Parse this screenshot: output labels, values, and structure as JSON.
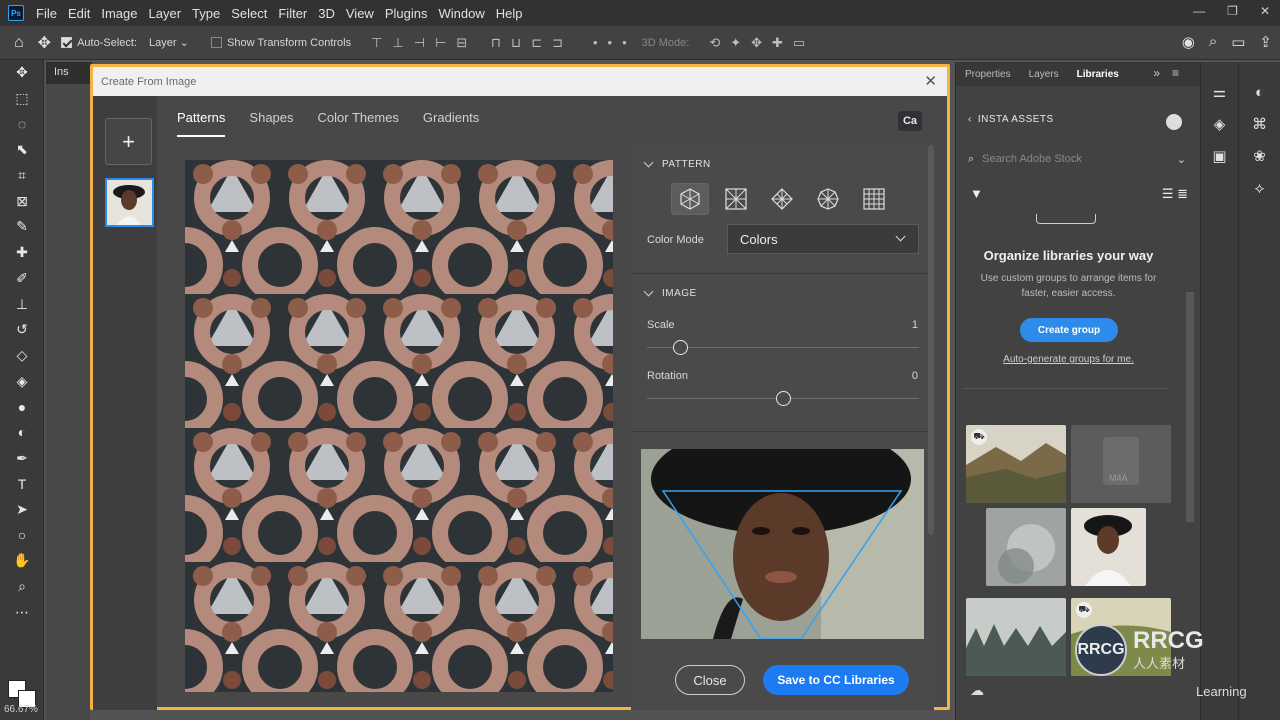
{
  "menubar": {
    "app_icon": "Ps",
    "items": [
      "File",
      "Edit",
      "Image",
      "Layer",
      "Type",
      "Select",
      "Filter",
      "3D",
      "View",
      "Plugins",
      "Window",
      "Help"
    ],
    "window_controls": [
      "—",
      "❐",
      "✕"
    ]
  },
  "options_bar": {
    "auto_select_label": "Auto-Select:",
    "auto_select_value": "Layer",
    "show_transform_label": "Show Transform Controls",
    "mode_3d_label": "3D Mode:"
  },
  "toolbar": {
    "tools": [
      {
        "name": "move-tool-icon",
        "glyph": "✥"
      },
      {
        "name": "marquee-tool-icon",
        "glyph": "⬚"
      },
      {
        "name": "lasso-tool-icon",
        "glyph": "◌"
      },
      {
        "name": "object-select-tool-icon",
        "glyph": "⬉"
      },
      {
        "name": "crop-tool-icon",
        "glyph": "⌗"
      },
      {
        "name": "frame-tool-icon",
        "glyph": "⊠"
      },
      {
        "name": "eyedropper-tool-icon",
        "glyph": "✎"
      },
      {
        "name": "healing-tool-icon",
        "glyph": "✚"
      },
      {
        "name": "brush-tool-icon",
        "glyph": "✐"
      },
      {
        "name": "stamp-tool-icon",
        "glyph": "⊥"
      },
      {
        "name": "history-brush-tool-icon",
        "glyph": "↺"
      },
      {
        "name": "eraser-tool-icon",
        "glyph": "◇"
      },
      {
        "name": "paint-bucket-tool-icon",
        "glyph": "◈"
      },
      {
        "name": "blur-tool-icon",
        "glyph": "●"
      },
      {
        "name": "dodge-tool-icon",
        "glyph": "◐"
      },
      {
        "name": "pen-tool-icon",
        "glyph": "✒"
      },
      {
        "name": "type-tool-icon",
        "glyph": "T"
      },
      {
        "name": "path-select-tool-icon",
        "glyph": "➤"
      },
      {
        "name": "shape-tool-icon",
        "glyph": "○"
      },
      {
        "name": "hand-tool-icon",
        "glyph": "✋"
      },
      {
        "name": "zoom-tool-icon",
        "glyph": "⌕"
      },
      {
        "name": "edit-toolbar-icon",
        "glyph": "⋯"
      }
    ],
    "zoom_readout": "66.67%"
  },
  "document": {
    "tab_label": "Ins"
  },
  "dialog": {
    "title": "Create From Image",
    "close_glyph": "✕",
    "add_glyph": "+",
    "tabs": [
      "Patterns",
      "Shapes",
      "Color Themes",
      "Gradients"
    ],
    "active_tab": "Patterns",
    "ca_badge": "Ca",
    "pattern_section": "PATTERN",
    "color_mode_label": "Color Mode",
    "color_mode_value": "Colors",
    "image_section": "IMAGE",
    "scale_label": "Scale",
    "scale_value": "1",
    "rotation_label": "Rotation",
    "rotation_value": "0",
    "close_button": "Close",
    "save_button": "Save to CC Libraries",
    "pattern_types": [
      "hexagon-pattern-icon",
      "square-pattern-icon",
      "diamond-pattern-icon",
      "circle-pattern-icon",
      "grid-pattern-icon"
    ],
    "slider_levels": {
      "scale": 0.12,
      "rotation": 0.5
    }
  },
  "right_panel": {
    "tabs": [
      "Properties",
      "Layers",
      "Libraries"
    ],
    "active_tab": "Libraries",
    "tabs_end_glyphs": "»≡",
    "library_name": "INSTA ASSETS",
    "search_placeholder": "Search Adobe Stock",
    "org_title": "Organize libraries your way",
    "org_desc": "Use custom groups to arrange items for faster, easier access.",
    "create_group_button": "Create group",
    "auto_group_link": "Auto-generate groups for me.",
    "audio_asset_label": "M4A"
  },
  "watermark": {
    "logo_text": "RRCG",
    "brand": "RRCG",
    "sub": "人人素材",
    "linkedin": "Learning"
  },
  "colors": {
    "dialog_border": "#f4b342",
    "accent_blue": "#1d7bf2",
    "panel_bg": "#4a4a4a"
  }
}
